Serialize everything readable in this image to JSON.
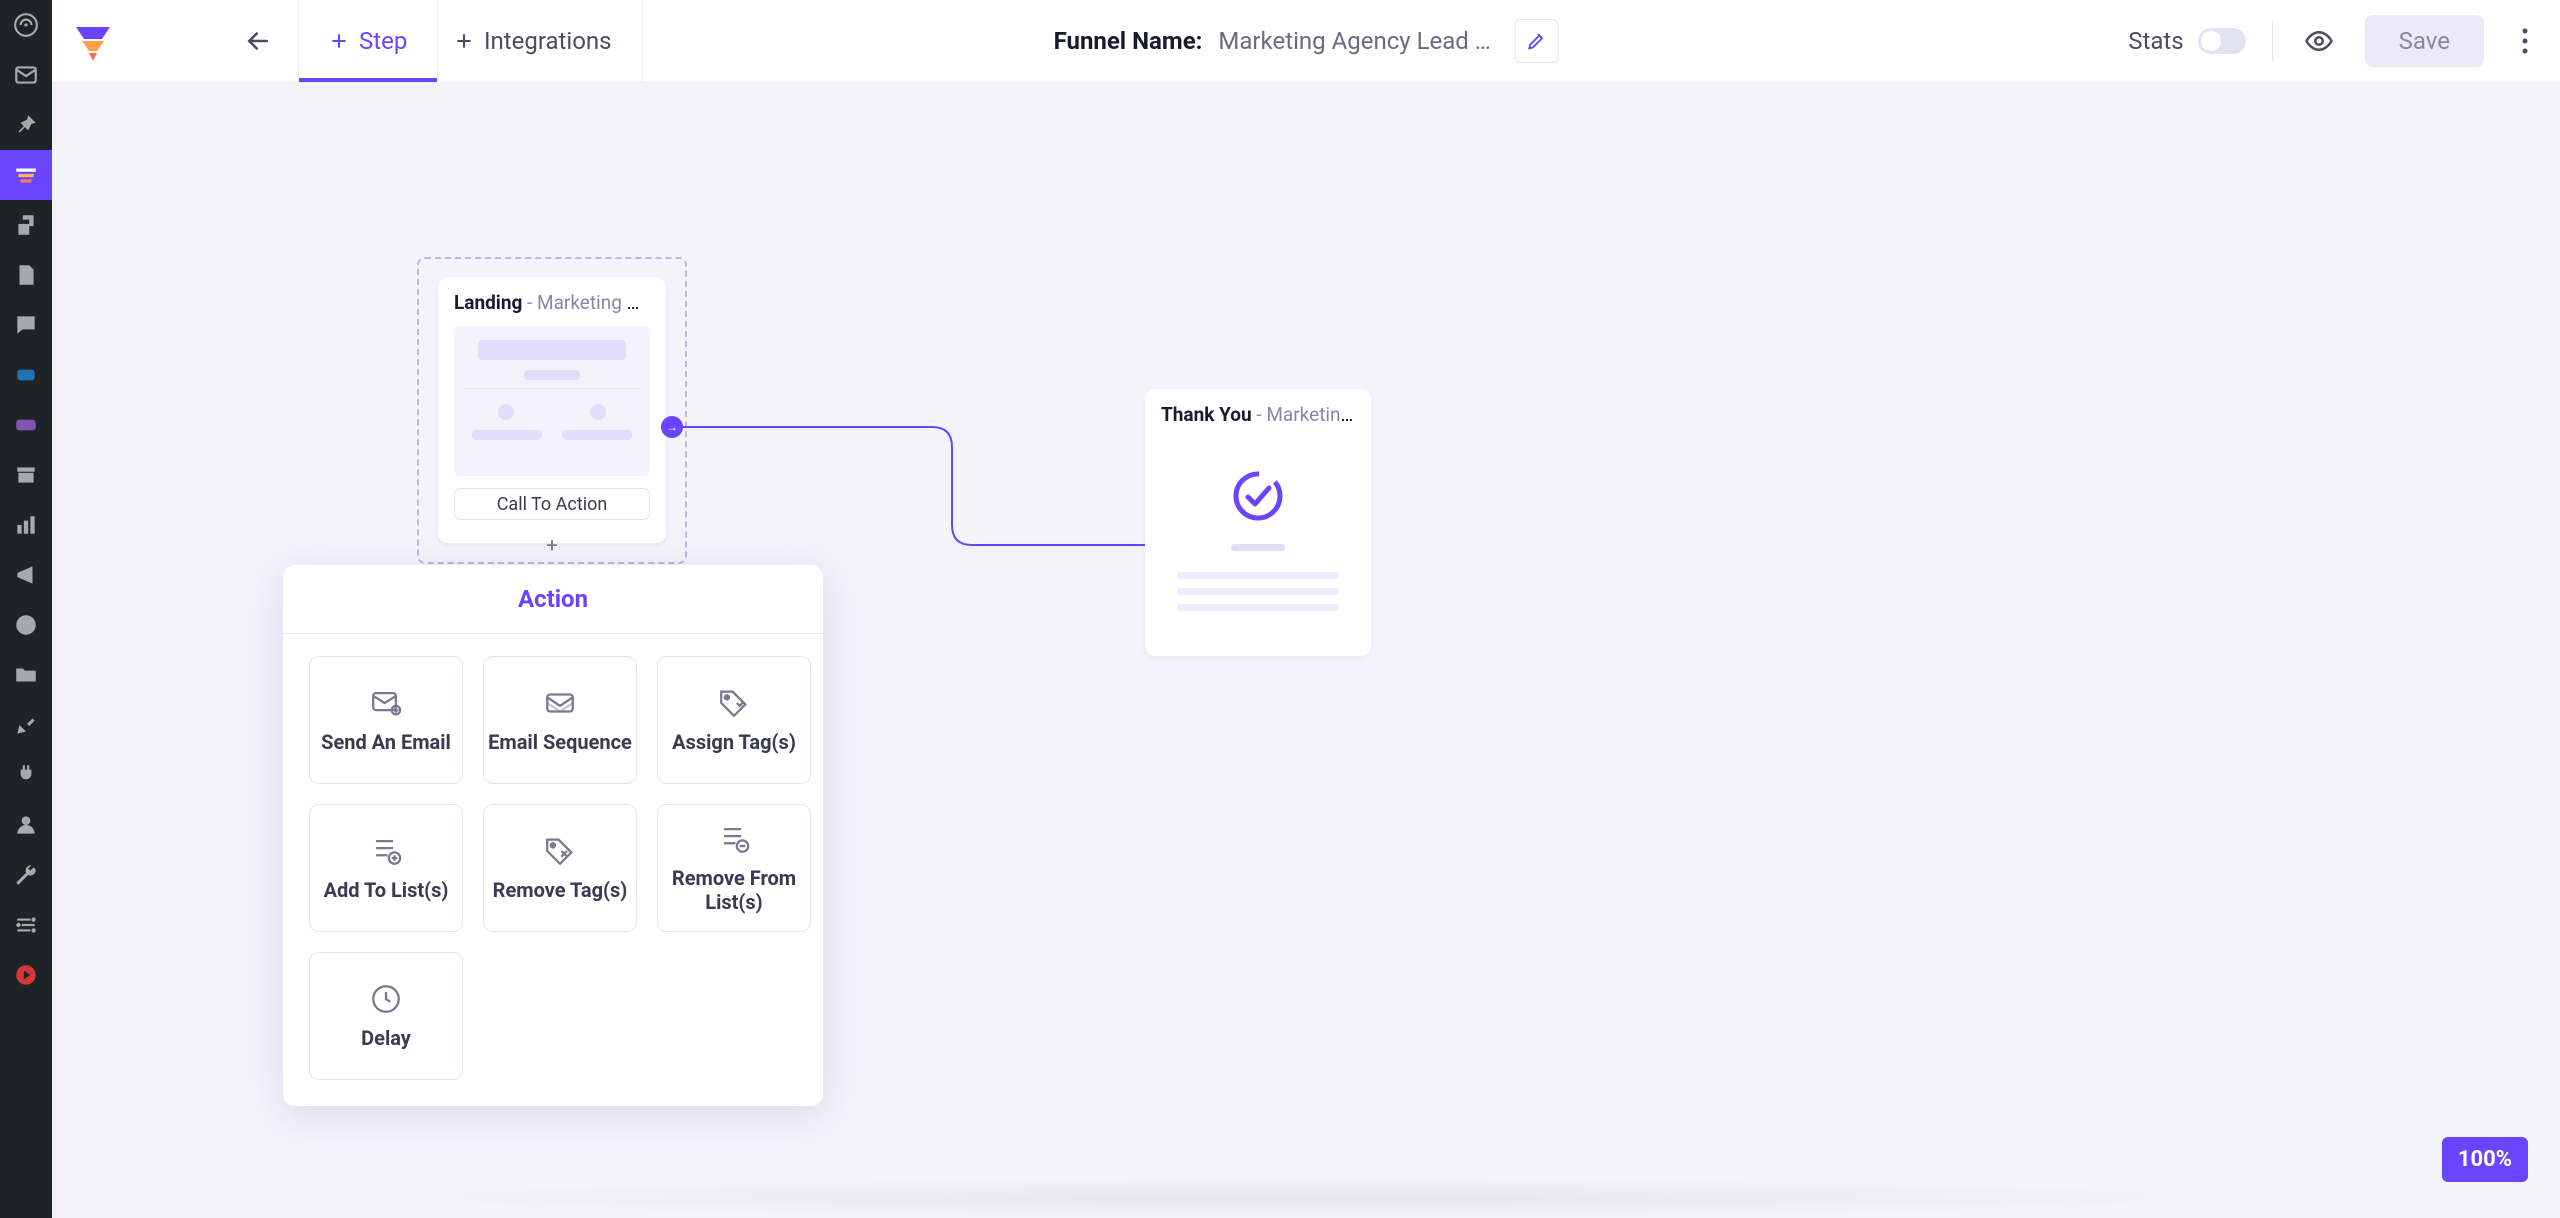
{
  "header": {
    "tabs": {
      "step": "Step",
      "integrations": "Integrations"
    },
    "funnel_label": "Funnel Name:",
    "funnel_value": "Marketing Agency Lead Gener…",
    "stats_label": "Stats",
    "save_label": "Save"
  },
  "canvas": {
    "landing": {
      "title_bold": "Landing",
      "title_rest": " - Marketing Age…",
      "cta": "Call To Action"
    },
    "thankyou": {
      "title_bold": "Thank You",
      "title_rest": " - Marketing Age…"
    }
  },
  "popover": {
    "title": "Action",
    "actions": {
      "send_email": "Send An Email",
      "email_sequence": "Email Sequence",
      "assign_tags": "Assign Tag(s)",
      "add_to_lists": "Add To List(s)",
      "remove_tags": "Remove Tag(s)",
      "remove_from_lists": "Remove From List(s)",
      "delay": "Delay"
    }
  },
  "zoom": "100%"
}
